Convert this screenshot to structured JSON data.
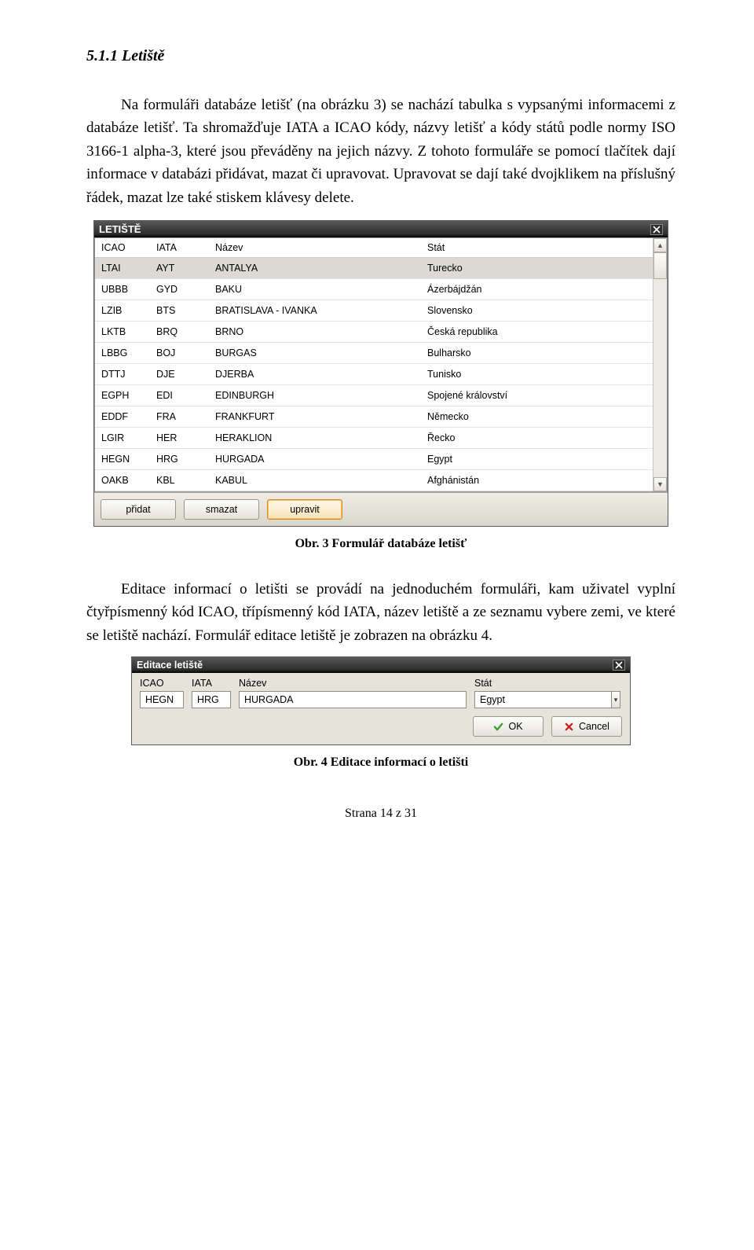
{
  "heading": "5.1.1  Letiště",
  "para1": "Na formuláři databáze letišť (na obrázku 3) se nachází tabulka s vypsanými informacemi z databáze letišť. Ta shromažďuje IATA a ICAO kódy, názvy letišť a kódy států podle normy ISO 3166-1 alpha-3, které jsou převáděny na jejich názvy. Z tohoto formuláře se pomocí tlačítek dají informace v databázi přidávat, mazat či upravovat. Upravovat se dají také dvojklikem na příslušný řádek, mazat lze také stiskem klávesy delete.",
  "caption1": "Obr. 3 Formulář databáze letišť",
  "para2": "Editace informací o letišti se provádí na jednoduchém formuláři, kam uživatel vyplní čtyřpísmenný kód ICAO, třípísmenný kód IATA, název letiště a ze seznamu vybere zemi, ve které se letiště nachází. Formulář editace letiště je zobrazen na obrázku 4.",
  "caption2": "Obr. 4 Editace informací o letišti",
  "pagenum": "Strana 14 z 31",
  "window": {
    "title": "LETIŠTĚ",
    "headers": {
      "icao": "ICAO",
      "iata": "IATA",
      "nazev": "Název",
      "stat": "Stát"
    },
    "rows": [
      {
        "icao": "LTAI",
        "iata": "AYT",
        "nazev": "ANTALYA",
        "stat": "Turecko",
        "selected": true
      },
      {
        "icao": "UBBB",
        "iata": "GYD",
        "nazev": "BAKU",
        "stat": "Ázerbájdžán"
      },
      {
        "icao": "LZIB",
        "iata": "BTS",
        "nazev": "BRATISLAVA - IVANKA",
        "stat": "Slovensko"
      },
      {
        "icao": "LKTB",
        "iata": "BRQ",
        "nazev": "BRNO",
        "stat": "Česká republika"
      },
      {
        "icao": "LBBG",
        "iata": "BOJ",
        "nazev": "BURGAS",
        "stat": "Bulharsko"
      },
      {
        "icao": "DTTJ",
        "iata": "DJE",
        "nazev": "DJERBA",
        "stat": "Tunisko"
      },
      {
        "icao": "EGPH",
        "iata": "EDI",
        "nazev": "EDINBURGH",
        "stat": "Spojené království"
      },
      {
        "icao": "EDDF",
        "iata": "FRA",
        "nazev": "FRANKFURT",
        "stat": "Německo"
      },
      {
        "icao": "LGIR",
        "iata": "HER",
        "nazev": "HERAKLION",
        "stat": "Řecko"
      },
      {
        "icao": "HEGN",
        "iata": "HRG",
        "nazev": "HURGADA",
        "stat": "Egypt"
      },
      {
        "icao": "OAKB",
        "iata": "KBL",
        "nazev": "KABUL",
        "stat": "Afghánistán"
      }
    ],
    "buttons": {
      "add": "přidat",
      "delete": "smazat",
      "edit": "upravit"
    }
  },
  "dialog": {
    "title": "Editace letiště",
    "labels": {
      "icao": "ICAO",
      "iata": "IATA",
      "nazev": "Název",
      "stat": "Stát"
    },
    "values": {
      "icao": "HEGN",
      "iata": "HRG",
      "nazev": "HURGADA",
      "stat": "Egypt"
    },
    "ok": "OK",
    "cancel": "Cancel"
  }
}
